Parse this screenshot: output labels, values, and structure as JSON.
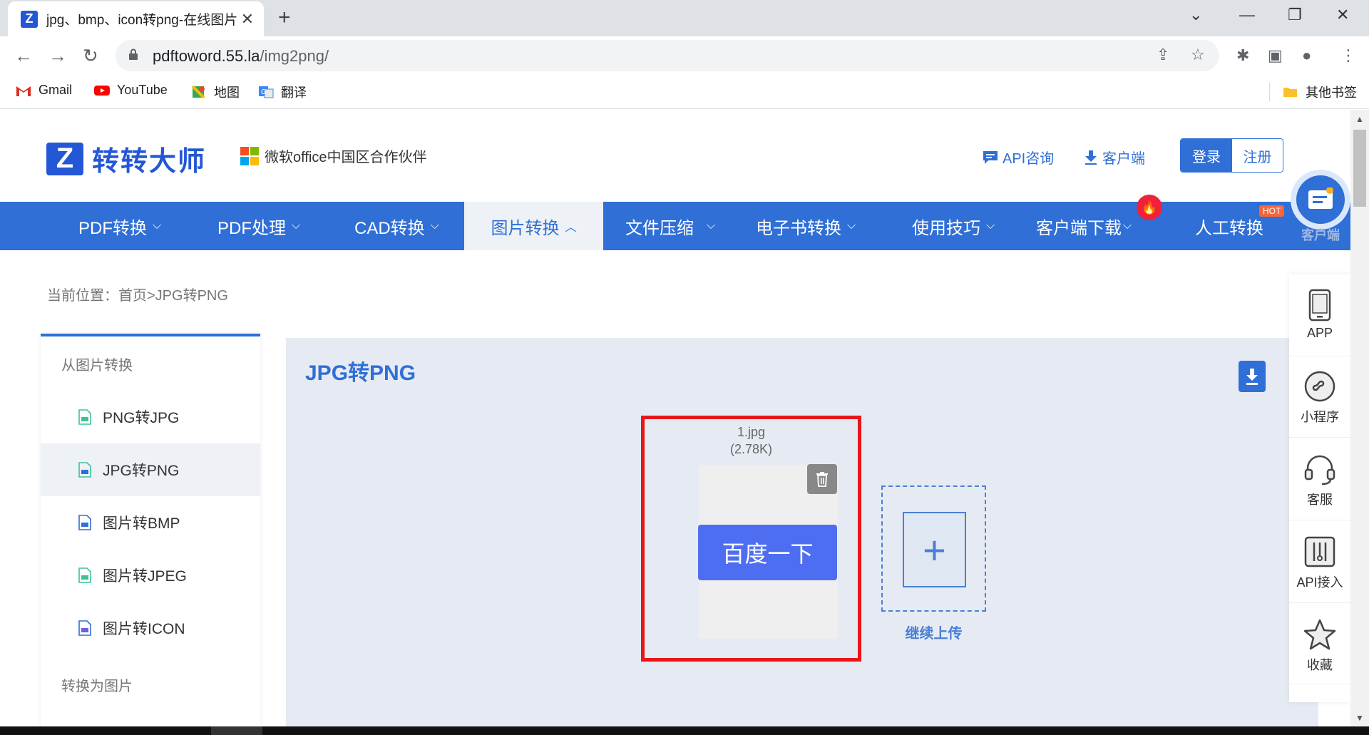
{
  "browser": {
    "tab_title": "jpg、bmp、icon转png-在线图片",
    "tab_favicon": "Z",
    "url_host": "pdftoword.55.la",
    "url_path": "/img2png/"
  },
  "bookmarks": [
    {
      "label": "Gmail",
      "icon": "gmail-icon"
    },
    {
      "label": "YouTube",
      "icon": "youtube-icon"
    },
    {
      "label": "地图",
      "icon": "maps-icon"
    },
    {
      "label": "翻译",
      "icon": "translate-icon"
    }
  ],
  "other_bookmarks": "其他书签",
  "header": {
    "logo_mark": "Z",
    "logo_text": "转转大师",
    "partner_text": "微软office中国区合作伙伴",
    "api_link": "API咨询",
    "client_link": "客户端",
    "login": "登录",
    "register": "注册"
  },
  "nav": {
    "items": [
      "PDF转换",
      "PDF处理",
      "CAD转换",
      "图片转换",
      "文件压缩",
      "电子书转换",
      "使用技巧",
      "客户端下载",
      "人工转换"
    ],
    "active_index": 3,
    "hot_badge": "HOT",
    "chevron_down": "⌵",
    "chevron_up": "︿"
  },
  "float_client_label": "客户端",
  "breadcrumb": "当前位置：首页>JPG转PNG",
  "sidebar": {
    "group1": "从图片转换",
    "items": [
      "PNG转JPG",
      "JPG转PNG",
      "图片转BMP",
      "图片转JPEG",
      "图片转ICON"
    ],
    "active_index": 1,
    "group2": "转换为图片"
  },
  "work": {
    "title": "JPG转PNG",
    "file_name": "1.jpg",
    "file_size": "(2.78K)",
    "preview_button": "百度一下",
    "add_label": "继续上传",
    "add_symbol": "+"
  },
  "rightbar": [
    "APP",
    "小程序",
    "客服",
    "API接入",
    "收藏"
  ],
  "colors": {
    "brand": "#2f6fd6",
    "highlight_border": "#e8161b",
    "baidu_button": "#4e6ef2"
  }
}
